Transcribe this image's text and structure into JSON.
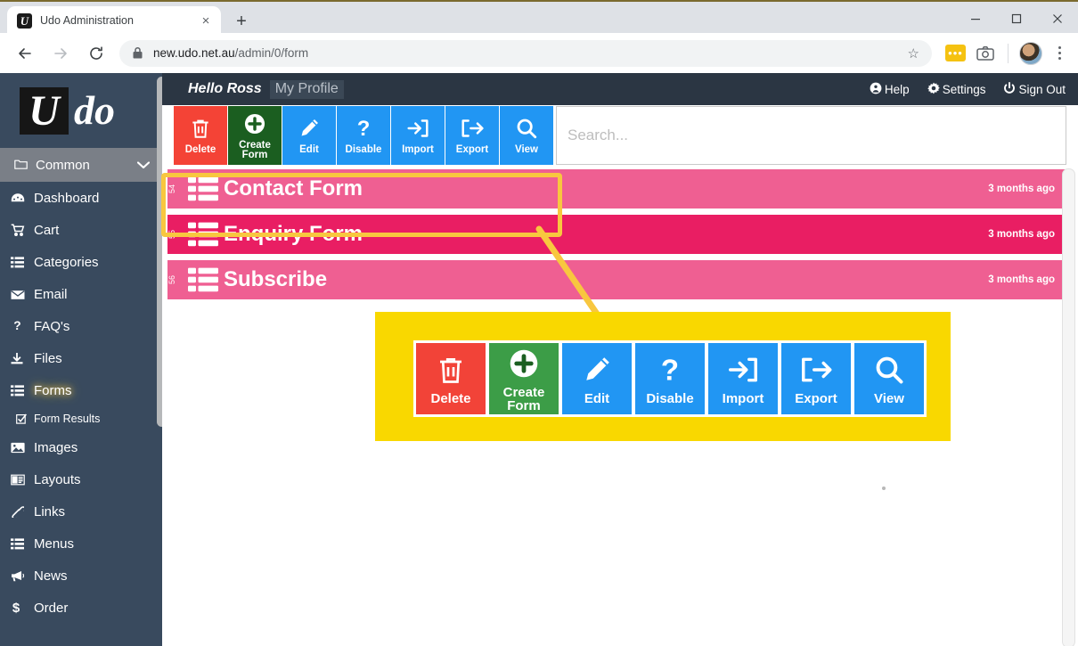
{
  "browser": {
    "tab_title": "Udo Administration",
    "favicon_letter": "U",
    "new_tab_label": "+",
    "close_tab_label": "×",
    "url_host": "new.udo.net.au",
    "url_path": "/admin/0/form",
    "ext_dots": "•••",
    "star_label": "☆"
  },
  "brand": {
    "logo_u": "U",
    "logo_do": "do"
  },
  "topbar": {
    "hello": "Hello Ross",
    "my_profile": "My Profile",
    "links": [
      {
        "icon": "help-icon",
        "glyph": "❓",
        "label": "Help"
      },
      {
        "icon": "gear-icon",
        "glyph": "⚙",
        "label": "Settings"
      },
      {
        "icon": "power-icon",
        "glyph": "⏻",
        "label": "Sign Out"
      }
    ]
  },
  "sidebar": {
    "group": {
      "label": "Common",
      "icon": "folder-icon",
      "chevron": "chevron-down-icon"
    },
    "items": [
      {
        "label": "Dashboard",
        "icon": "dashboard-icon",
        "sub": false,
        "active": false
      },
      {
        "label": "Cart",
        "icon": "cart-icon",
        "sub": false,
        "active": false
      },
      {
        "label": "Categories",
        "icon": "list-icon",
        "sub": false,
        "active": false
      },
      {
        "label": "Email",
        "icon": "envelope-icon",
        "sub": false,
        "active": false
      },
      {
        "label": "FAQ's",
        "icon": "question-icon",
        "sub": false,
        "active": false
      },
      {
        "label": "Files",
        "icon": "download-icon",
        "sub": false,
        "active": false
      },
      {
        "label": "Forms",
        "icon": "forms-icon",
        "sub": false,
        "active": true
      },
      {
        "label": "Form Results",
        "icon": "check-square-icon",
        "sub": true,
        "active": false
      },
      {
        "label": "Images",
        "icon": "image-icon",
        "sub": false,
        "active": false
      },
      {
        "label": "Layouts",
        "icon": "layout-icon",
        "sub": false,
        "active": false
      },
      {
        "label": "Links",
        "icon": "link-icon",
        "sub": false,
        "active": false
      },
      {
        "label": "Menus",
        "icon": "menu-icon",
        "sub": false,
        "active": false
      },
      {
        "label": "News",
        "icon": "megaphone-icon",
        "sub": false,
        "active": false
      },
      {
        "label": "Order",
        "icon": "dollar-icon",
        "sub": false,
        "active": false
      }
    ]
  },
  "toolbar": {
    "buttons": [
      {
        "label": "Delete",
        "icon": "trash-icon",
        "color": "#f44336",
        "style": "red"
      },
      {
        "label": "Create\nForm",
        "icon": "plus-circle-icon",
        "color": "#1b5e20",
        "style": "green"
      },
      {
        "label": "Edit",
        "icon": "pencil-icon",
        "color": "#2196f3",
        "style": "blue"
      },
      {
        "label": "Disable",
        "icon": "question-icon",
        "color": "#2196f3",
        "style": "blue"
      },
      {
        "label": "Import",
        "icon": "sign-in-icon",
        "color": "#2196f3",
        "style": "blue"
      },
      {
        "label": "Export",
        "icon": "sign-out-icon",
        "color": "#2196f3",
        "style": "blue"
      },
      {
        "label": "View",
        "icon": "magnifier-icon",
        "color": "#2196f3",
        "style": "blue"
      }
    ]
  },
  "search": {
    "placeholder": "Search..."
  },
  "forms": {
    "rows": [
      {
        "num": "54",
        "name": "Contact Form",
        "age": "3 months ago",
        "color": "#ef5f92"
      },
      {
        "num": "55",
        "name": "Enquiry Form",
        "age": "3 months ago",
        "color": "#e91e63"
      },
      {
        "num": "56",
        "name": "Subscribe",
        "age": "3 months ago",
        "color": "#ef5f92"
      }
    ]
  },
  "callout": {
    "highlight_color": "#f8c73f",
    "panel_color": "#f9d800",
    "buttons": [
      {
        "label": "Delete",
        "icon": "trash-icon",
        "style": "red"
      },
      {
        "label": "Create\nForm",
        "icon": "plus-circle-icon",
        "style": "green"
      },
      {
        "label": "Edit",
        "icon": "pencil-icon",
        "style": "blue"
      },
      {
        "label": "Disable",
        "icon": "question-icon",
        "style": "blue"
      },
      {
        "label": "Import",
        "icon": "sign-in-icon",
        "style": "blue"
      },
      {
        "label": "Export",
        "icon": "sign-out-icon",
        "style": "blue"
      },
      {
        "label": "View",
        "icon": "magnifier-icon",
        "style": "blue"
      }
    ]
  }
}
